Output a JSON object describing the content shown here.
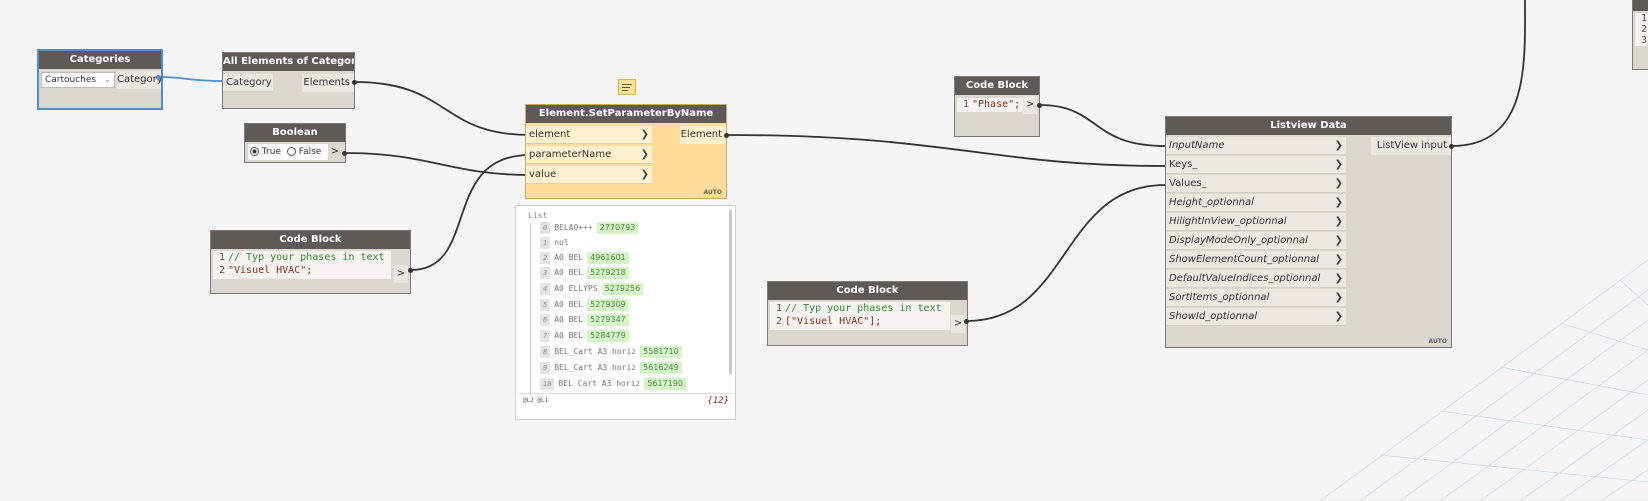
{
  "nodes": {
    "categories": {
      "title": "Categories",
      "dropdown_value": "Cartouches",
      "output": "Category"
    },
    "all_elements": {
      "title": "All Elements of Category",
      "input": "Category",
      "output": "Elements"
    },
    "boolean": {
      "title": "Boolean",
      "true_label": "True",
      "false_label": "False",
      "output": ">"
    },
    "code_block_1": {
      "title": "Code Block",
      "line1_no": "1",
      "line1": "// Typ your phases in text",
      "line2_no": "2",
      "line2": "\"Visuel HVAC\";",
      "output": ">"
    },
    "set_param": {
      "title": "Element.SetParameterByName",
      "inputs": [
        "element",
        "parameterName",
        "value"
      ],
      "output": "Element",
      "auto": "AUTO"
    },
    "code_block_phase": {
      "title": "Code Block",
      "line1_no": "1",
      "line1": "\"Phase\";",
      "output": ">"
    },
    "code_block_2": {
      "title": "Code Block",
      "line1_no": "1",
      "line1": "// Typ your phases in text",
      "line2_no": "2",
      "line2": "[\"Visuel HVAC\"];",
      "output": ">"
    },
    "listview": {
      "title": "Listview Data",
      "inputs": [
        "InputName",
        "Keys_",
        "Values_",
        "Height_optionnal",
        "HilightInView_optionnal",
        "DisplayModeOnly_optionnal",
        "ShowElementCount_optionnal",
        "DefaultValueIndices_optionnal",
        "SortItems_optionnal",
        "ShowId_optionnal"
      ],
      "output": "ListView input",
      "auto": "AUTO"
    }
  },
  "preview": {
    "header": "List",
    "items": [
      {
        "idx": "0",
        "label": "BELAO+++",
        "value": "2770793"
      },
      {
        "idx": "1",
        "label": "nul",
        "value": ""
      },
      {
        "idx": "2",
        "label": "A0 BEL",
        "value": "4961601"
      },
      {
        "idx": "3",
        "label": "A0 BEL",
        "value": "5279218"
      },
      {
        "idx": "4",
        "label": "A0 ELLYPS",
        "value": "5279256"
      },
      {
        "idx": "5",
        "label": "A0 BEL",
        "value": "5279309"
      },
      {
        "idx": "6",
        "label": "A0 BEL",
        "value": "5279347"
      },
      {
        "idx": "7",
        "label": "A0 BEL",
        "value": "5284779"
      },
      {
        "idx": "8",
        "label": "BEL_Cart A3 horiz",
        "value": "5581710"
      },
      {
        "idx": "9",
        "label": "BEL_Cart A3 horiz",
        "value": "5616249"
      },
      {
        "idx": "10",
        "label": "BEL Cart A3 horiz",
        "value": "5617190"
      }
    ],
    "levels": "@L2 @L1",
    "count": "{12}"
  },
  "corner_list": [
    "1",
    "2",
    "3"
  ],
  "colors": {
    "wire": "#333333",
    "selected_wire": "#4a90d0",
    "node_header": "#5f5a55",
    "frozen_node": "#fedd9b",
    "preview_value_bg": "#d6f5c6"
  }
}
